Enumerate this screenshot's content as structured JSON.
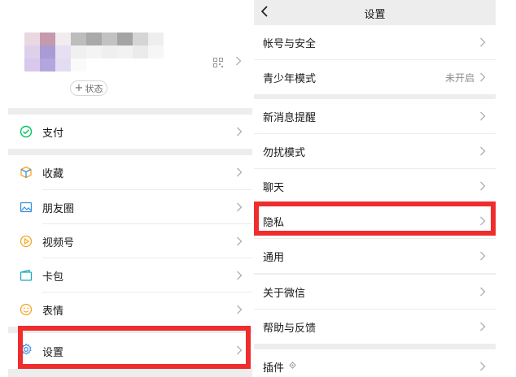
{
  "left": {
    "profile": {
      "status_button_plus": "+",
      "status_button_label": "状态"
    },
    "menu": [
      {
        "label": "支付",
        "icon": "wechat-pay-icon"
      },
      {
        "label": "收藏",
        "icon": "favorites-cube-icon"
      },
      {
        "label": "朋友圈",
        "icon": "moments-photo-icon"
      },
      {
        "label": "视频号",
        "icon": "channels-play-icon"
      },
      {
        "label": "卡包",
        "icon": "card-wallet-icon"
      },
      {
        "label": "表情",
        "icon": "sticker-smile-icon"
      },
      {
        "label": "设置",
        "icon": "gear-icon"
      }
    ]
  },
  "right": {
    "title": "设置",
    "items": [
      {
        "label": "帐号与安全"
      },
      {
        "label": "青少年模式",
        "value": "未开启"
      },
      {
        "label": "新消息提醒"
      },
      {
        "label": "勿扰模式"
      },
      {
        "label": "聊天"
      },
      {
        "label": "隐私"
      },
      {
        "label": "通用"
      },
      {
        "label": "关于微信"
      },
      {
        "label": "帮助与反馈"
      },
      {
        "label": "插件"
      }
    ]
  },
  "colors": {
    "highlight": "#ef2d2d",
    "background_gray": "#ededed",
    "icon_green": "#07c160",
    "icon_blue": "#3a8de0",
    "icon_orange": "#f5a623",
    "icon_teal": "#1aa9c5"
  }
}
